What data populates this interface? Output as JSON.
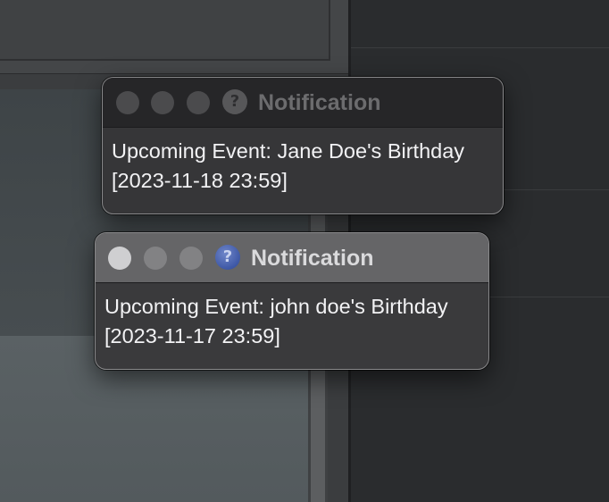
{
  "notifications": [
    {
      "title": "Notification",
      "title_icon": "question-icon",
      "icon_glyph": "?",
      "state": "inactive",
      "message_line1": "Upcoming Event: Jane Doe's Birthday",
      "message_line2": "[2023-11-18 23:59]"
    },
    {
      "title": "Notification",
      "title_icon": "question-icon",
      "icon_glyph": "?",
      "state": "active",
      "message_line1": "Upcoming Event: john doe's Birthday",
      "message_line2": "[2023-11-17 23:59]"
    }
  ],
  "colors": {
    "active_titlebar": "#656567",
    "inactive_titlebar": "#262628",
    "window_body": "#3a3a3c",
    "question_icon_blue": "#3e58a6"
  }
}
